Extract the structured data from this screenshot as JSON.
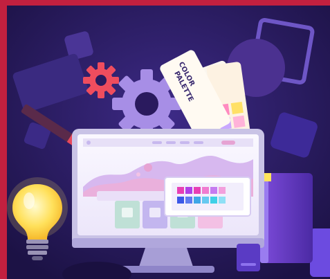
{
  "illustration": {
    "palette_card_text": [
      "COLOR",
      "PALETTE"
    ],
    "colors": {
      "frame": "#c2203f",
      "background": "#2a1a5e",
      "monitor_bezel": "#c9c3e6",
      "screen": "#f4f1fb",
      "accent_pink": "#e9a3d6",
      "accent_purple": "#8e63d9",
      "gear_red": "#ef4d5e",
      "gear_lavender": "#a78ee6",
      "bulb_yellow": "#ffd84a"
    },
    "icons": [
      "lightbulb-icon",
      "gear-icon",
      "pencil-icon",
      "color-swatch-icon",
      "monitor-icon"
    ]
  }
}
